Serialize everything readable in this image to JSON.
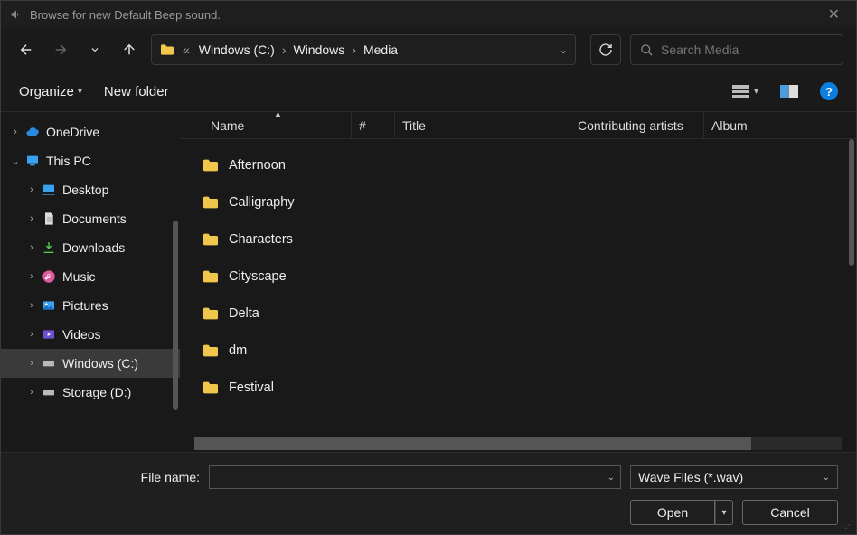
{
  "titlebar": {
    "text": "Browse for new Default Beep sound."
  },
  "breadcrumb": [
    "Windows (C:)",
    "Windows",
    "Media"
  ],
  "search": {
    "placeholder": "Search Media"
  },
  "toolbar": {
    "organize": "Organize",
    "new_folder": "New folder"
  },
  "columns": {
    "name": "Name",
    "hash": "#",
    "title": "Title",
    "artists": "Contributing artists",
    "album": "Album"
  },
  "tree": [
    {
      "label": "OneDrive",
      "icon": "cloud",
      "caret": "right",
      "indent": 0
    },
    {
      "label": "This PC",
      "icon": "pc",
      "caret": "down",
      "indent": 0
    },
    {
      "label": "Desktop",
      "icon": "desktop",
      "caret": "right",
      "indent": 1
    },
    {
      "label": "Documents",
      "icon": "doc",
      "caret": "right",
      "indent": 1
    },
    {
      "label": "Downloads",
      "icon": "download",
      "caret": "right",
      "indent": 1
    },
    {
      "label": "Music",
      "icon": "music",
      "caret": "right",
      "indent": 1
    },
    {
      "label": "Pictures",
      "icon": "pictures",
      "caret": "right",
      "indent": 1
    },
    {
      "label": "Videos",
      "icon": "videos",
      "caret": "right",
      "indent": 1
    },
    {
      "label": "Windows (C:)",
      "icon": "drive",
      "caret": "right",
      "indent": 1,
      "selected": true
    },
    {
      "label": "Storage (D:)",
      "icon": "drive",
      "caret": "right",
      "indent": 1
    }
  ],
  "files": [
    {
      "name": "Afternoon"
    },
    {
      "name": "Calligraphy"
    },
    {
      "name": "Characters"
    },
    {
      "name": "Cityscape"
    },
    {
      "name": "Delta"
    },
    {
      "name": "dm"
    },
    {
      "name": "Festival"
    }
  ],
  "footer": {
    "filename_label": "File name:",
    "filename_value": "",
    "filter": "Wave Files (*.wav)",
    "open": "Open",
    "cancel": "Cancel"
  }
}
